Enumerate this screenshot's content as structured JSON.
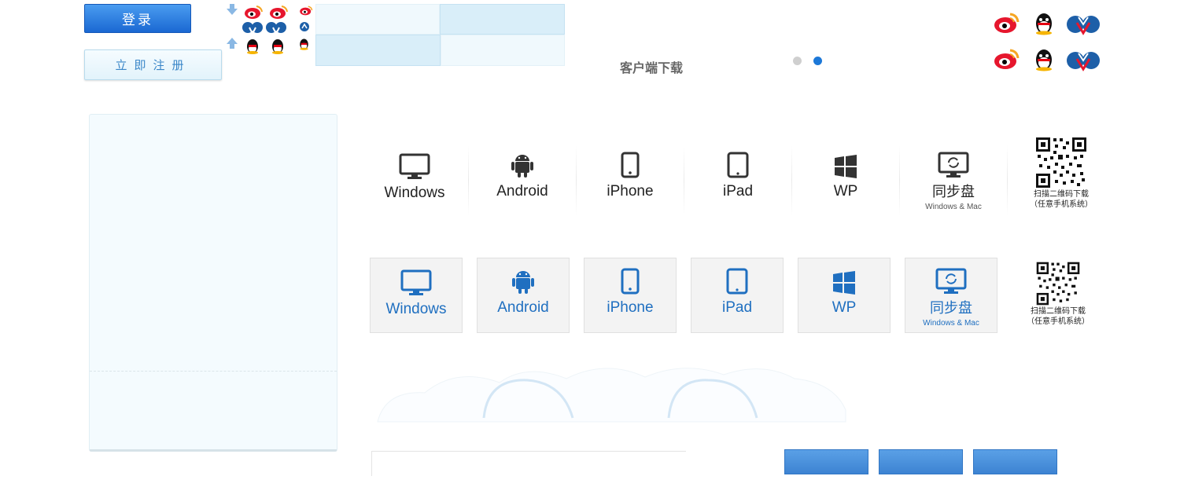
{
  "header": {
    "login_label": "登录",
    "register_label": "立即注册",
    "client_download": "客户端下载"
  },
  "colors": {
    "accent": "#1a68d2",
    "platform_blue": "#1f6fc0",
    "weibo_red": "#e6162d"
  },
  "social_icons": [
    "weibo-icon",
    "qq-penguin-icon",
    "renren-icon"
  ],
  "carousel": {
    "active_index": 1,
    "count": 2
  },
  "platforms": {
    "windows": "Windows",
    "android": "Android",
    "iphone": "iPhone",
    "ipad": "iPad",
    "wp": "WP",
    "sync": "同步盘",
    "sync_sub": "Windows & Mac",
    "qr_line1": "扫描二维码下载",
    "qr_line2": "（任意手机系统）"
  }
}
